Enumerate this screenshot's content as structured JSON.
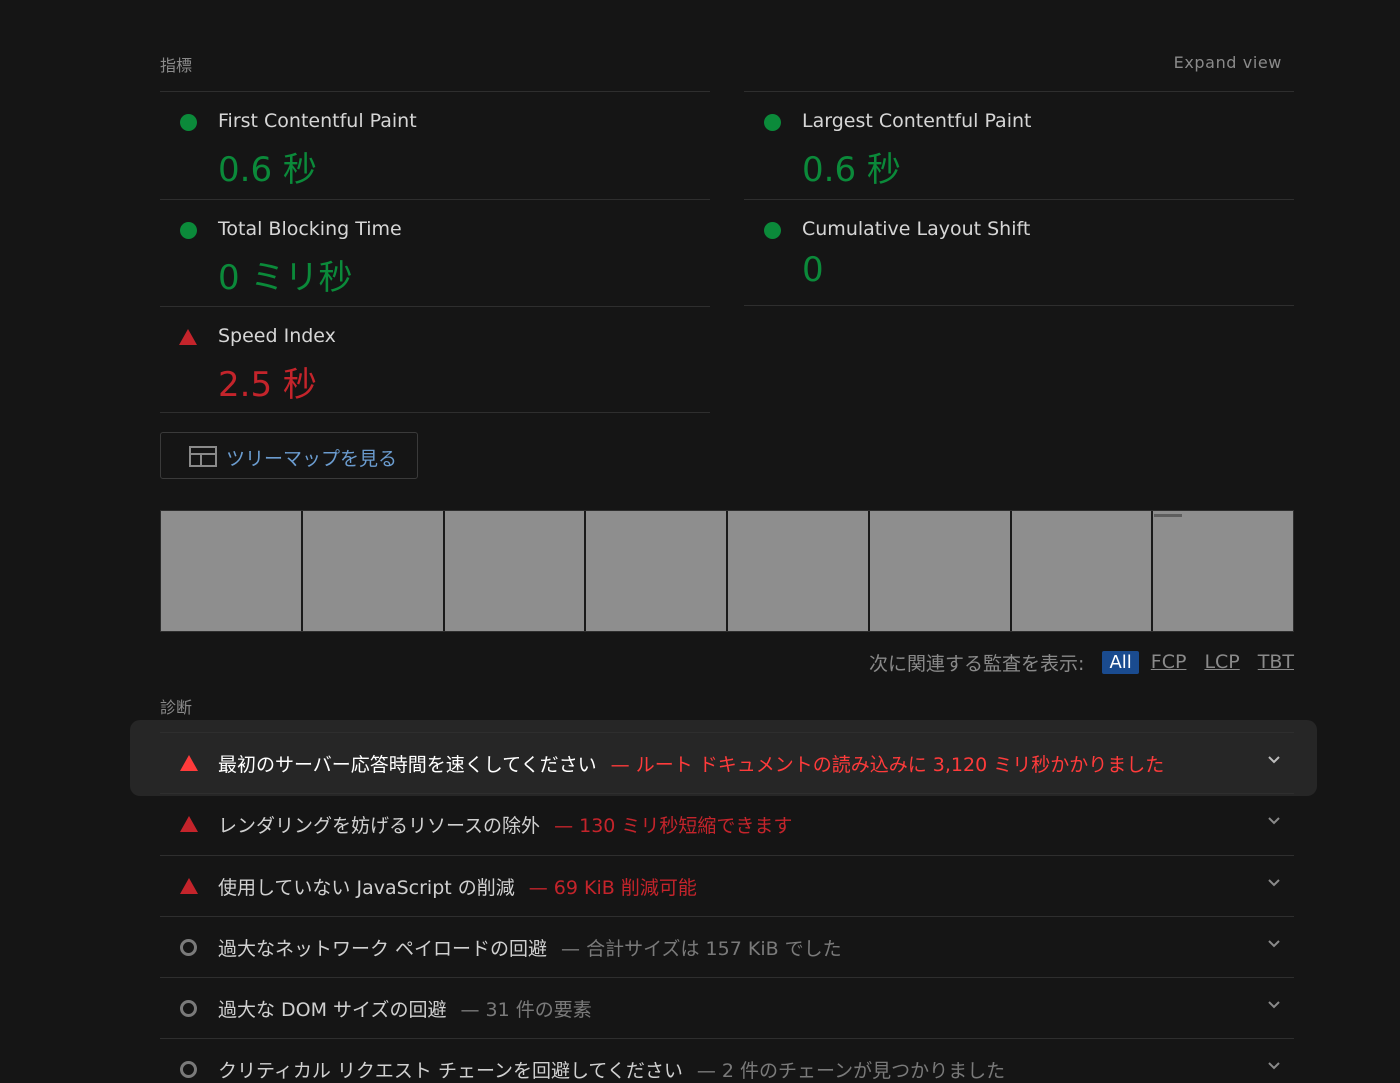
{
  "metrics_header": {
    "title": "指標",
    "expand_label": "Expand view"
  },
  "metrics": [
    {
      "label": "First Contentful Paint",
      "value": "0.6 秒",
      "status": "pass"
    },
    {
      "label": "Largest Contentful Paint",
      "value": "0.6 秒",
      "status": "pass"
    },
    {
      "label": "Total Blocking Time",
      "value": "0 ミリ秒",
      "status": "pass"
    },
    {
      "label": "Cumulative Layout Shift",
      "value": "0",
      "status": "pass"
    },
    {
      "label": "Speed Index",
      "value": "2.5 秒",
      "status": "fail"
    }
  ],
  "treemap": {
    "label": "ツリーマップを見る",
    "icon": "treemap-icon"
  },
  "filmstrip": {
    "frame_count": 8
  },
  "filter": {
    "label": "次に関連する監査を表示:",
    "chips": [
      "All",
      "FCP",
      "LCP",
      "TBT"
    ],
    "selected": "All"
  },
  "diagnostics": {
    "title": "診断",
    "audits": [
      {
        "title": "最初のサーバー応答時間を速くしてください",
        "description": "— ルート ドキュメントの読み込みに 3,120 ミリ秒かかりました",
        "status": "fail",
        "highlighted": true
      },
      {
        "title": "レンダリングを妨げるリソースの除外",
        "description": "— 130 ミリ秒短縮できます",
        "status": "fail",
        "highlighted": false
      },
      {
        "title": "使用していない JavaScript の削減",
        "description": "— 69 KiB 削減可能",
        "status": "fail",
        "highlighted": false
      },
      {
        "title": "過大なネットワーク ペイロードの回避",
        "description": "— 合計サイズは 157 KiB でした",
        "status": "info",
        "highlighted": false
      },
      {
        "title": "過大な DOM サイズの回避",
        "description": "— 31 件の要素",
        "status": "info",
        "highlighted": false
      },
      {
        "title": "クリティカル リクエスト チェーンを回避してください",
        "description": "— 2 件のチェーンが見つかりました",
        "status": "info",
        "highlighted": false
      }
    ]
  },
  "colors": {
    "pass": "#0b8a3a",
    "fail": "#c4242b",
    "fail_highlight": "#ff3b3b",
    "link": "#6b9ccf",
    "chip_selected": "#1a4b8f"
  }
}
